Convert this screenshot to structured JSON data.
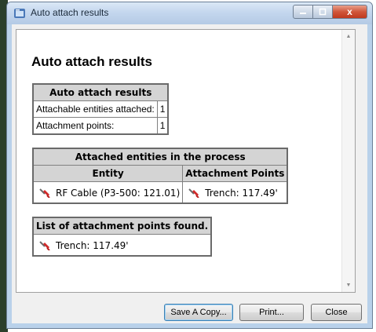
{
  "window": {
    "title": "Auto attach results",
    "close_glyph": "x"
  },
  "report": {
    "heading": "Auto attach results",
    "summary_table": {
      "header": "Auto attach results",
      "rows": [
        {
          "label": "Attachable entities attached:",
          "value": "1"
        },
        {
          "label": "Attachment points:",
          "value": "1"
        }
      ]
    },
    "entities_table": {
      "header": "Attached entities in the process",
      "columns": [
        "Entity",
        "Attachment Points"
      ],
      "rows": [
        {
          "entity": "RF Cable (P3-500: 121.01)",
          "attachment_point": "Trench: 117.49'"
        }
      ]
    },
    "points_table": {
      "header": "List of attachment points found.",
      "rows": [
        {
          "point": "Trench: 117.49'"
        }
      ]
    }
  },
  "buttons": {
    "save_copy": "Save A Copy...",
    "print": "Print...",
    "close": "Close"
  },
  "icons": {
    "title": "window-app-icon",
    "entity": "cable-plug-icon"
  },
  "colors": {
    "table_header_bg": "#d4d4d4",
    "titlebar": "#c4d7ee",
    "close_button": "#c0391e"
  }
}
